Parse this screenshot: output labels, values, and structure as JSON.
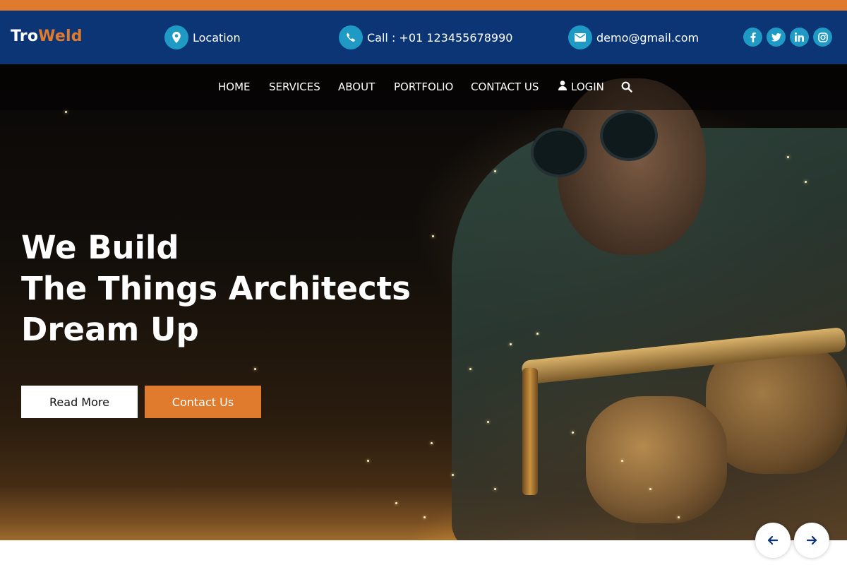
{
  "brand": {
    "part1": "Tro",
    "part2": "Weld"
  },
  "header": {
    "location": "Location",
    "call": "Call : +01 123455678990",
    "email": "demo@gmail.com"
  },
  "social": [
    "facebook-icon",
    "twitter-icon",
    "linkedin-icon",
    "instagram-icon"
  ],
  "nav": {
    "home": "HOME",
    "services": "SERVICES",
    "about": "ABOUT",
    "portfolio": "PORTFOLIO",
    "contact": "CONTACT US",
    "login": "LOGIN"
  },
  "hero": {
    "line1": "We Build",
    "line2": "The Things Architects",
    "line3": "Dream Up",
    "read_more": "Read More",
    "contact_us": "Contact Us"
  },
  "colors": {
    "accent": "#e07a2c",
    "header_bg": "#0b3575",
    "icon_bg": "#1e9ac4"
  }
}
